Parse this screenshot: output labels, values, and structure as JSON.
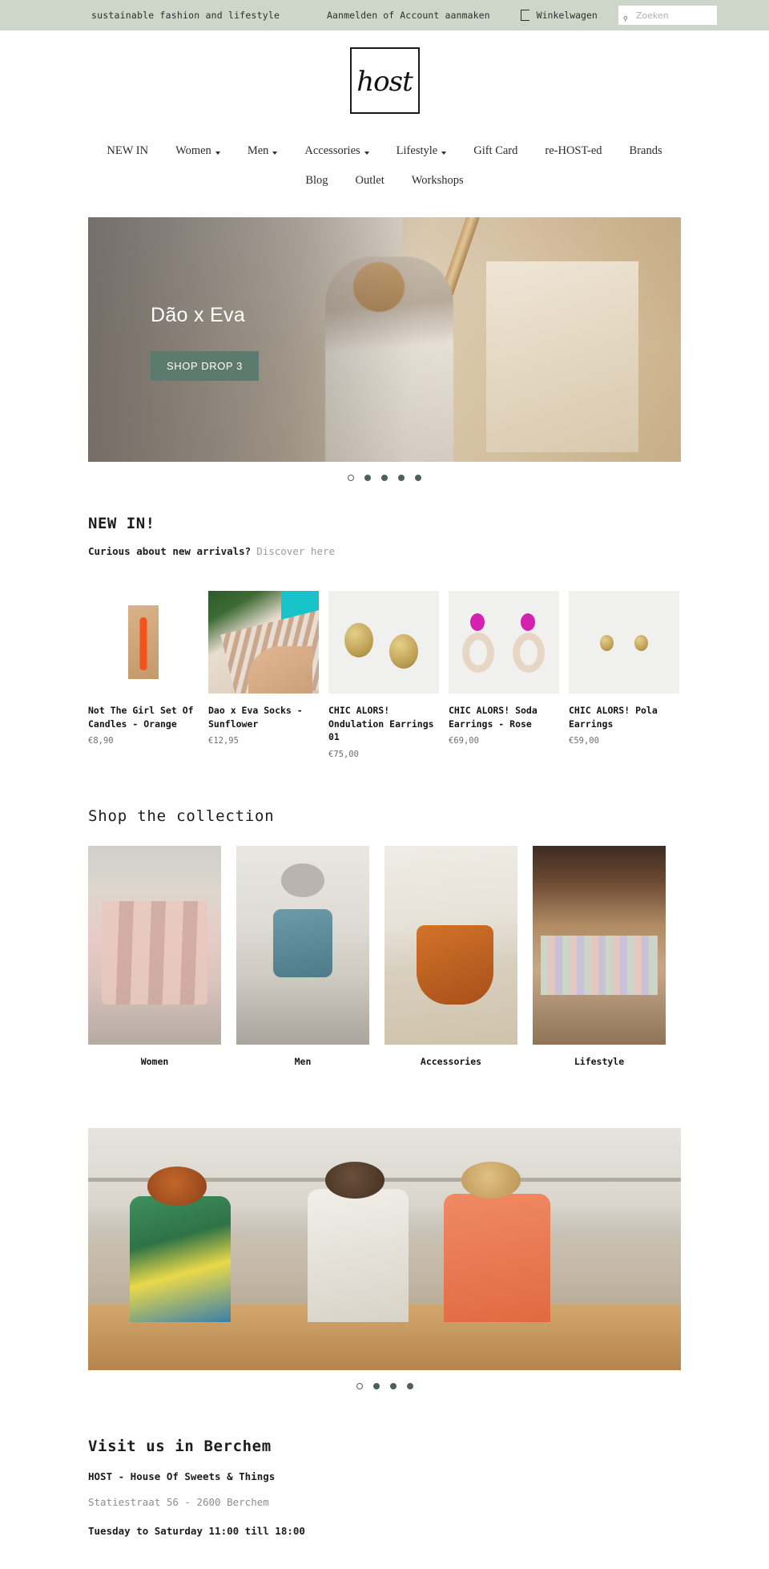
{
  "topbar": {
    "tagline": "sustainable fashion and lifestyle",
    "signin_label": "Aanmelden",
    "separator": "of",
    "register_label": "Account aanmaken",
    "cart_label": "Winkelwagen",
    "cart_icon": "shopping-bag-icon",
    "search_icon": "search-icon",
    "search_placeholder": "Zoeken",
    "search_value": "",
    "background_color": "#cdd6c8"
  },
  "logo": {
    "text": "host",
    "alt": "HOST logo"
  },
  "nav": {
    "row1": [
      {
        "label": "NEW IN",
        "has_dropdown": false
      },
      {
        "label": "Women",
        "has_dropdown": true
      },
      {
        "label": "Men",
        "has_dropdown": true
      },
      {
        "label": "Accessories",
        "has_dropdown": true
      },
      {
        "label": "Lifestyle",
        "has_dropdown": true
      },
      {
        "label": "Gift Card",
        "has_dropdown": false
      },
      {
        "label": "re-HOST-ed",
        "has_dropdown": false
      },
      {
        "label": "Brands",
        "has_dropdown": false
      }
    ],
    "row2": [
      {
        "label": "Blog",
        "has_dropdown": false
      },
      {
        "label": "Outlet",
        "has_dropdown": false
      },
      {
        "label": "Workshops",
        "has_dropdown": false
      }
    ]
  },
  "hero": {
    "title": "Dão x Eva",
    "cta_label": "SHOP DROP 3",
    "cta_color": "#5c7a6e",
    "dots_total": 5,
    "dots_active": 1
  },
  "newin": {
    "heading": "NEW IN!",
    "subtitle": "Curious about new arrivals?",
    "link_label": "Discover here",
    "products": [
      {
        "title": "Not The Girl Set Of Candles - Orange",
        "price": "€8,90",
        "art": "candle"
      },
      {
        "title": "Dao x Eva Socks - Sunflower",
        "price": "€12,95",
        "art": "socks"
      },
      {
        "title": "CHIC ALORS! Ondulation Earrings 01",
        "price": "€75,00",
        "art": "gold-discs"
      },
      {
        "title": "CHIC ALORS! Soda Earrings - Rose",
        "price": "€69,00",
        "art": "pink-hoops"
      },
      {
        "title": "CHIC ALORS! Pola Earrings",
        "price": "€59,00",
        "art": "small-gold"
      }
    ]
  },
  "collection": {
    "heading": "Shop the collection",
    "categories": [
      {
        "label": "Women"
      },
      {
        "label": "Men"
      },
      {
        "label": "Accessories"
      },
      {
        "label": "Lifestyle"
      }
    ]
  },
  "banner2": {
    "dots_total": 4,
    "dots_active": 1
  },
  "visit": {
    "heading": "Visit us in Berchem",
    "store_name": "HOST - House Of Sweets & Things",
    "address": "Statiestraat 56 - 2600 Berchem",
    "hours": "Tuesday to Saturday 11:00 till 18:00"
  }
}
